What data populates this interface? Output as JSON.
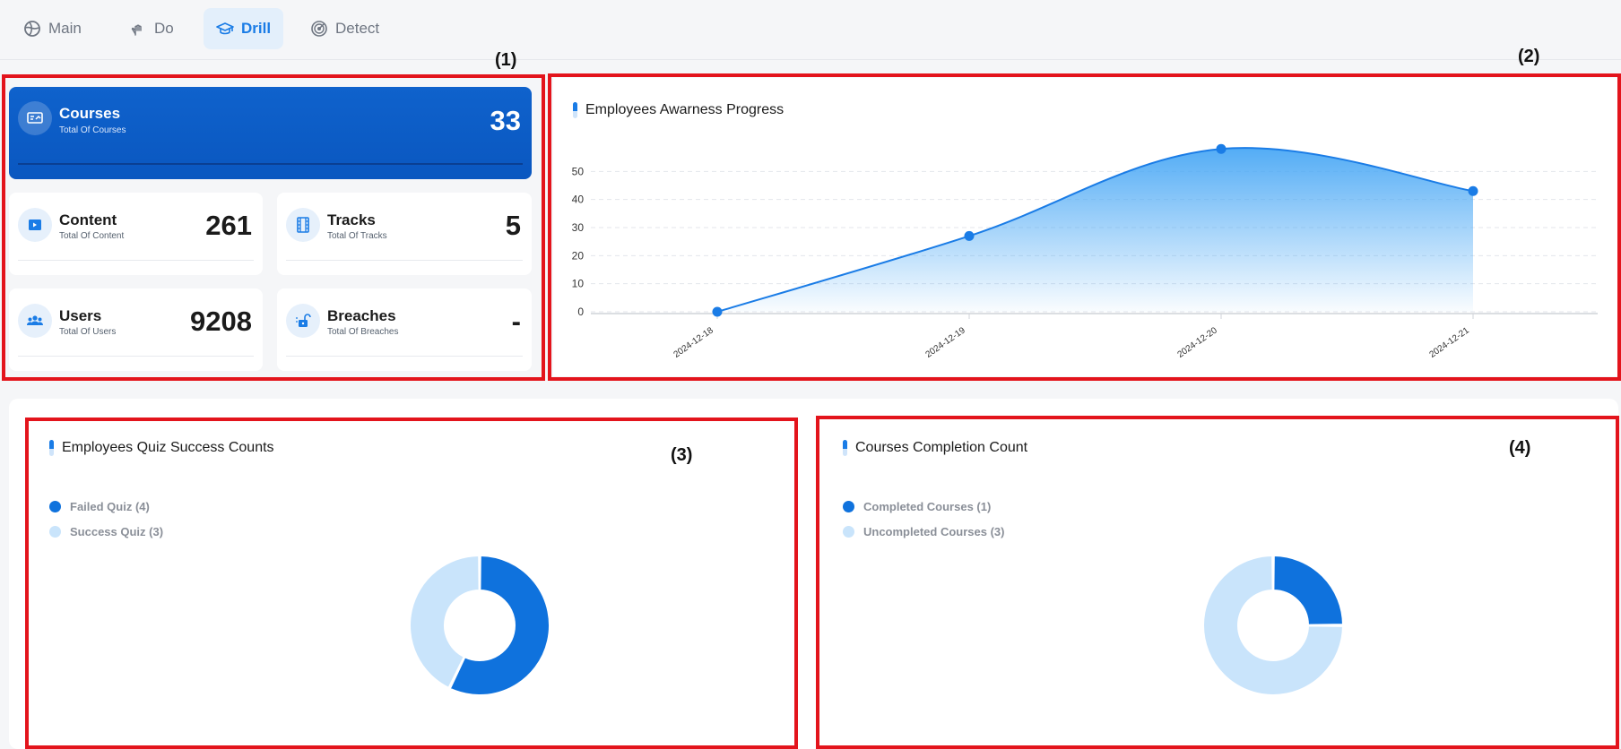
{
  "nav": {
    "tabs": [
      {
        "label": "Main",
        "icon": "globe-icon"
      },
      {
        "label": "Do",
        "icon": "hand-icon"
      },
      {
        "label": "Drill",
        "icon": "graduation-cap-icon",
        "active": true
      },
      {
        "label": "Detect",
        "icon": "radar-icon"
      }
    ]
  },
  "markers": [
    "(1)",
    "(2)",
    "(3)",
    "(4)"
  ],
  "stats": {
    "courses": {
      "title": "Courses",
      "subtitle": "Total Of Courses",
      "value": "33"
    },
    "content": {
      "title": "Content",
      "subtitle": "Total Of Content",
      "value": "261"
    },
    "tracks": {
      "title": "Tracks",
      "subtitle": "Total Of Tracks",
      "value": "5"
    },
    "users": {
      "title": "Users",
      "subtitle": "Total Of Users",
      "value": "9208"
    },
    "breaches": {
      "title": "Breaches",
      "subtitle": "Total Of Breaches",
      "value": "-"
    }
  },
  "colors": {
    "accent": "#1a7ce6",
    "primary_card": "#0f62cc",
    "donut_dark": "#0f72dd",
    "donut_light": "#c9e4fb",
    "annotation": "#e3141c"
  },
  "chart_data": [
    {
      "type": "area",
      "title": "Employees Awarness Progress",
      "x": [
        "2024-12-18",
        "2024-12-19",
        "2024-12-20",
        "2024-12-21"
      ],
      "series": [
        {
          "values": [
            0,
            27,
            58,
            43
          ]
        }
      ],
      "yticks": [
        0,
        10,
        20,
        30,
        40,
        50
      ],
      "ylim": [
        0,
        60
      ],
      "grid": true
    },
    {
      "type": "pie",
      "title": "Employees Quiz Success Counts",
      "labels": [
        "Failed Quiz (4)",
        "Success Quiz (3)"
      ],
      "values": [
        4,
        3
      ],
      "legend": "top-left"
    },
    {
      "type": "pie",
      "title": "Courses Completion Count",
      "labels": [
        "Completed Courses (1)",
        "Uncompleted Courses (3)"
      ],
      "values": [
        1,
        3
      ],
      "legend": "top-left"
    }
  ]
}
